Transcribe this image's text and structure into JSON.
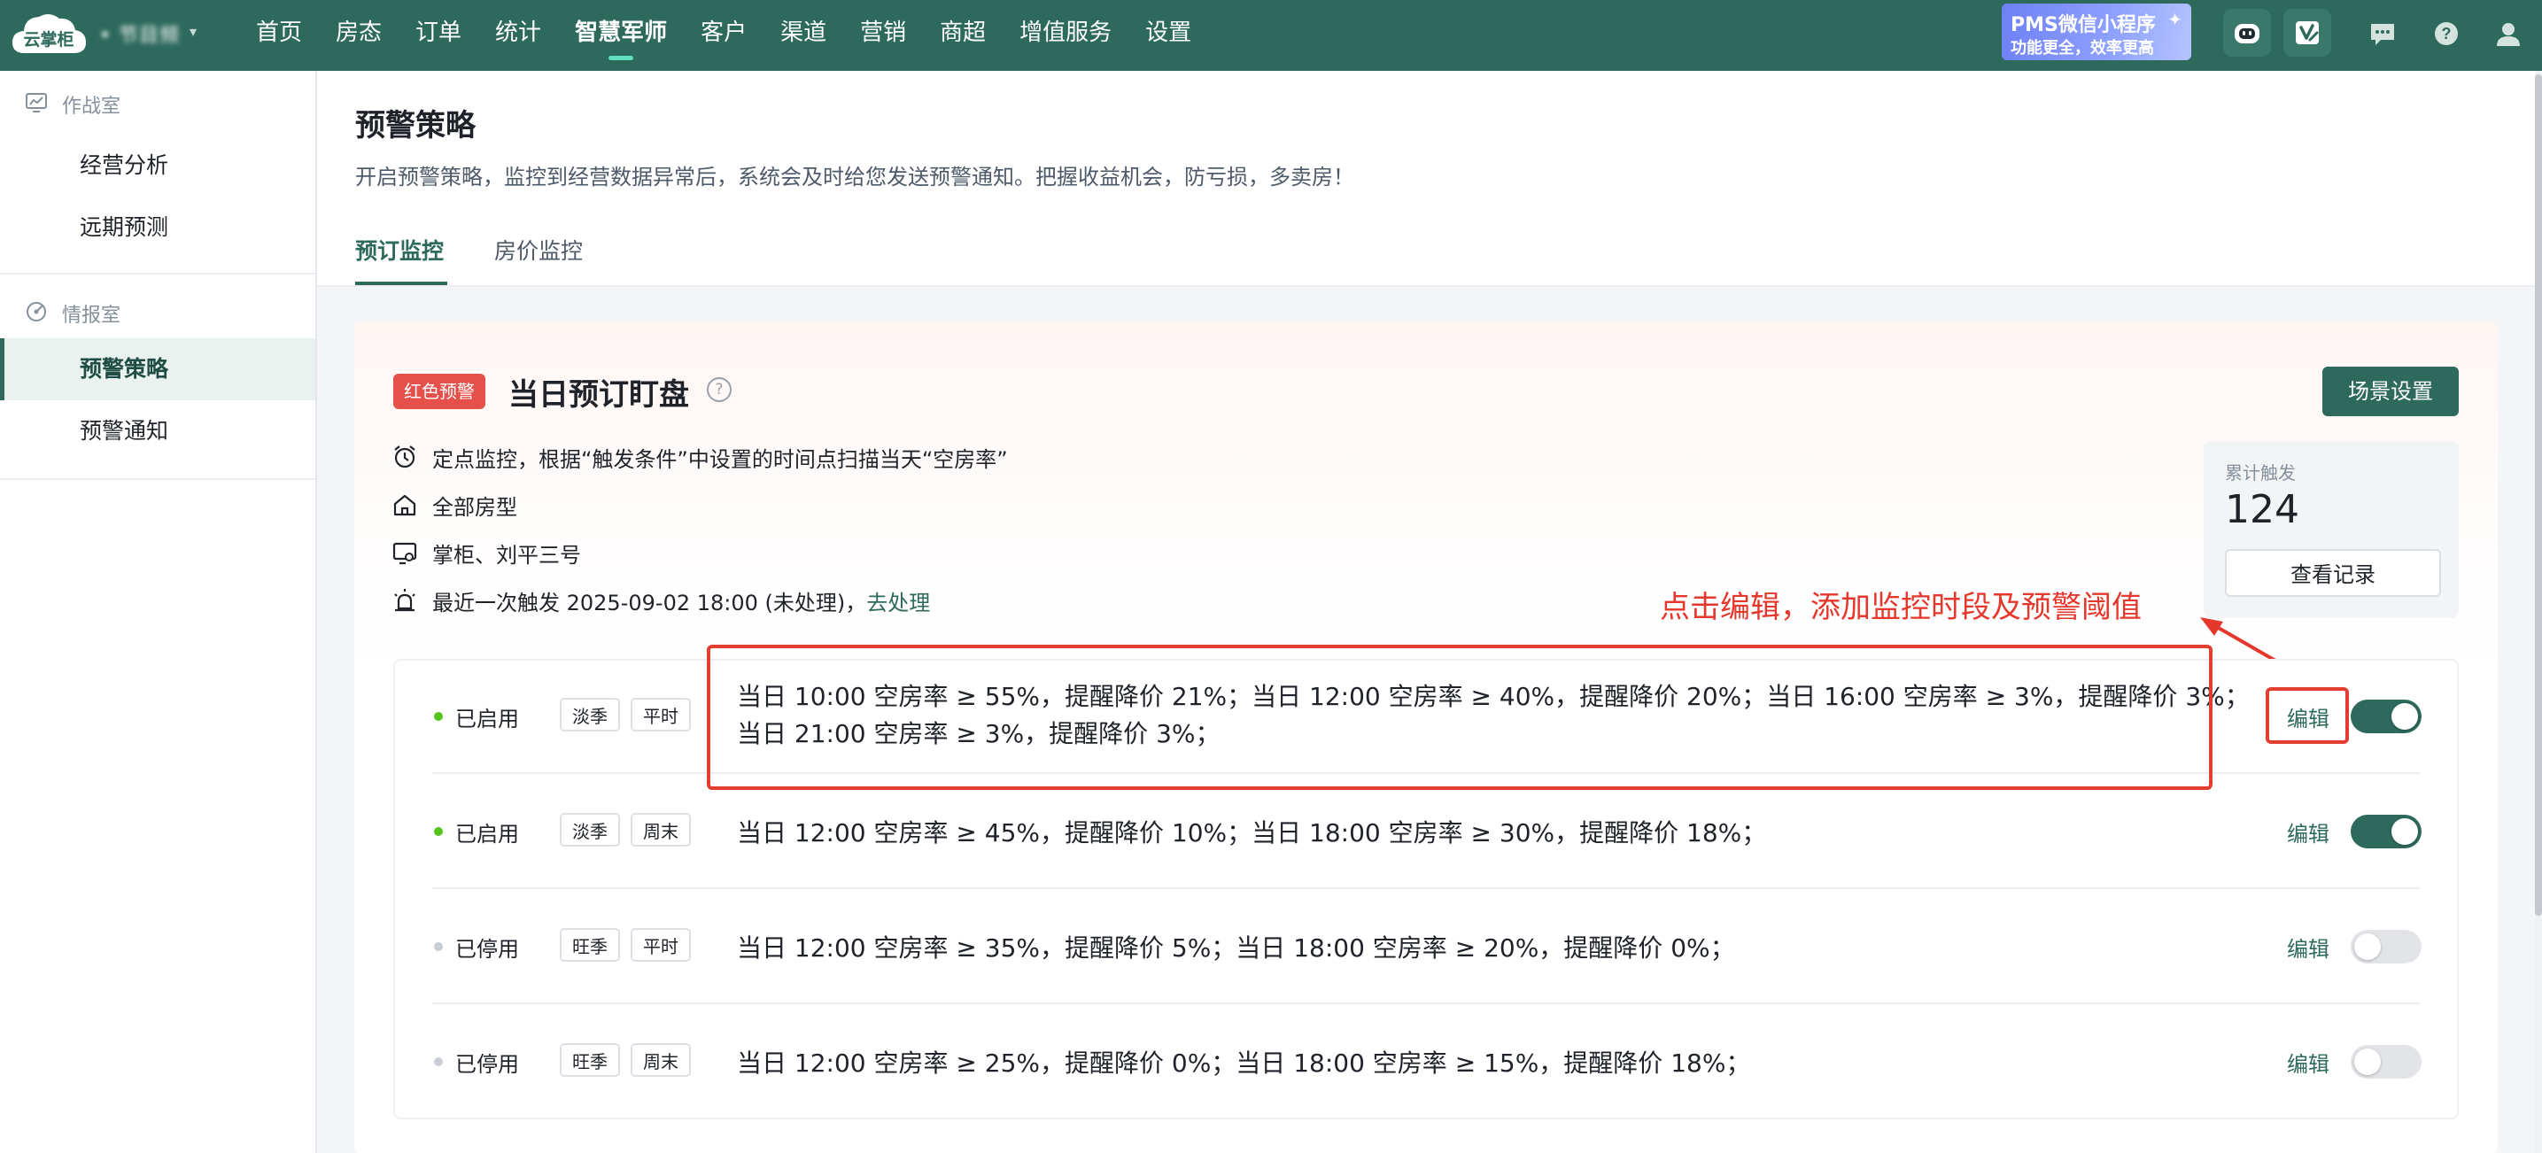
{
  "app": {
    "logo_text": "云掌柜",
    "hotel_name": "• 节目频"
  },
  "nav": {
    "items": [
      "首页",
      "房态",
      "订单",
      "统计",
      "智慧军师",
      "客户",
      "渠道",
      "营销",
      "商超",
      "增值服务",
      "设置"
    ],
    "active_index": 4
  },
  "promo": {
    "line1": "PMS微信小程序",
    "line2": "功能更全，效率更高"
  },
  "header_icons": [
    "robot-icon",
    "edit-check-icon",
    "message-icon",
    "help-icon",
    "user-icon"
  ],
  "sidebar": {
    "group1": "作战室",
    "group1_items": [
      "经营分析",
      "远期预测"
    ],
    "group2": "情报室",
    "group2_items": [
      "预警策略",
      "预警通知"
    ],
    "active_item": "预警策略"
  },
  "page": {
    "title": "预警策略",
    "description": "开启预警策略，监控到经营数据异常后，系统会及时给您发送预警通知。把握收益机会，防亏损，多卖房！",
    "tabs": [
      "预订监控",
      "房价监控"
    ],
    "active_tab": "预订监控"
  },
  "card": {
    "badge": "红色预警",
    "title": "当日预订盯盘",
    "help_glyph": "?",
    "scene_button": "场景设置",
    "info": {
      "schedule": "定点监控，根据“触发条件”中设置的时间点扫描当天“空房率”",
      "room_types": "全部房型",
      "recipients": "掌柜、刘平三号",
      "last_trigger_prefix": "最近一次触发 2025-09-02 18:00 (未处理)，",
      "go_handle": "去处理"
    },
    "stats": {
      "label": "累计触发",
      "value": "124",
      "button": "查看记录"
    }
  },
  "annotation": {
    "text": "点击编辑，添加监控时段及预警阈值",
    "color": "#e5372b"
  },
  "rules": [
    {
      "status": "已启用",
      "enabled": true,
      "tags": [
        "淡季",
        "平时"
      ],
      "line1": "当日 10:00 空房率 ≥ 55%，提醒降价 21%；当日 12:00 空房率 ≥ 40%，提醒降价 20%；当日 16:00 空房率 ≥ 3%，提醒降价 3%；",
      "line2": "当日 21:00 空房率 ≥ 3%，提醒降价 3%；",
      "edit": "编辑"
    },
    {
      "status": "已启用",
      "enabled": true,
      "tags": [
        "淡季",
        "周末"
      ],
      "line1": "当日 12:00 空房率 ≥ 45%，提醒降价 10%；当日 18:00 空房率 ≥ 30%，提醒降价 18%；",
      "edit": "编辑"
    },
    {
      "status": "已停用",
      "enabled": false,
      "tags": [
        "旺季",
        "平时"
      ],
      "line1": "当日 12:00 空房率 ≥ 35%，提醒降价 5%；当日 18:00 空房率 ≥ 20%，提醒降价 0%；",
      "edit": "编辑"
    },
    {
      "status": "已停用",
      "enabled": false,
      "tags": [
        "旺季",
        "周末"
      ],
      "line1": "当日 12:00 空房率 ≥ 25%，提醒降价 0%；当日 18:00 空房率 ≥ 15%，提醒降价 18%；",
      "edit": "编辑"
    }
  ],
  "colors": {
    "brand": "#2e6a5c",
    "danger": "#e5504b",
    "annotation": "#e5372b",
    "enabled_dot": "#52c41a"
  }
}
